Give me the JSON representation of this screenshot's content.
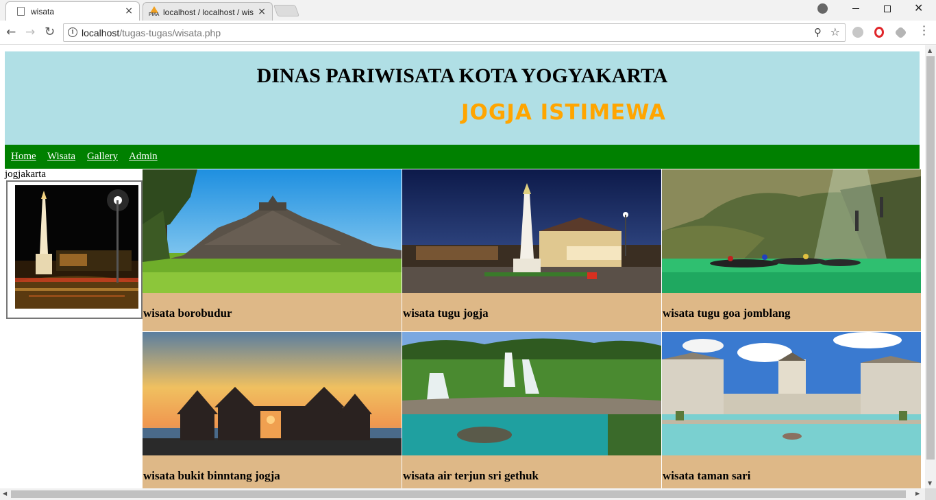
{
  "browser": {
    "tabs": [
      {
        "title": "wisata",
        "active": true
      },
      {
        "title": "localhost / localhost / wisata",
        "active": false
      }
    ],
    "url_host": "localhost",
    "url_path": "/tugas-tugas/wisata.php",
    "tab_close_glyph": "×",
    "icons": [
      "page-icon",
      "phpmyadmin-icon",
      "profile-icon",
      "back-icon",
      "forward-icon",
      "reload-icon",
      "info-icon",
      "zoom-icon",
      "star-icon",
      "globe-icon",
      "opera-icon",
      "extension-icon",
      "menu-icon"
    ],
    "pma_label": "PMA"
  },
  "page": {
    "header": {
      "title": "DINAS PARIWISATA KOTA YOGYAKARTA",
      "tagline": "JOGJA ISTIMEWA",
      "colors": {
        "background": "#b0dfe5",
        "tagline": "#ffa500"
      }
    },
    "nav": {
      "items": [
        "Home",
        "Wisata",
        "Gallery",
        "Admin"
      ],
      "background": "#008000"
    },
    "sidebar": {
      "title": "jogjakarta",
      "image": "tugu-jogja-night-photo"
    },
    "cards": [
      {
        "caption": "wisata borobudur",
        "image": "borobudur-temple-photo"
      },
      {
        "caption": "wisata tugu jogja",
        "image": "tugu-monument-photo"
      },
      {
        "caption": "wisata tugu goa jomblang",
        "image": "goa-jomblang-cave-photo"
      },
      {
        "caption": "wisata bukit binntang jogja",
        "image": "ratu-boko-sunset-photo"
      },
      {
        "caption": "wisata air terjun sri gethuk",
        "image": "sri-gethuk-waterfall-photo"
      },
      {
        "caption": "wisata taman sari",
        "image": "taman-sari-pool-photo"
      }
    ],
    "card_background": "#deb887"
  }
}
